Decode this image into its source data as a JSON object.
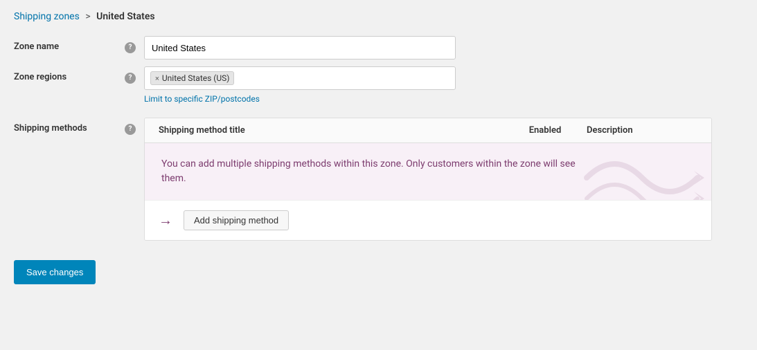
{
  "breadcrumb": {
    "link_text": "Shipping zones",
    "separator": ">",
    "current": "United States"
  },
  "zone_name": {
    "label": "Zone name",
    "value": "United States",
    "placeholder": ""
  },
  "zone_regions": {
    "label": "Zone regions",
    "tag": "United States (US)",
    "limit_link_text": "Limit to specific ZIP/postcodes"
  },
  "shipping_methods": {
    "label": "Shipping methods",
    "columns": {
      "title": "Shipping method title",
      "enabled": "Enabled",
      "description": "Description"
    },
    "info_text": "You can add multiple shipping methods within this zone. Only customers within the zone will see them.",
    "add_button_label": "Add shipping method"
  },
  "save_button_label": "Save changes",
  "icons": {
    "help": "?",
    "remove": "×",
    "arrow": "→"
  }
}
